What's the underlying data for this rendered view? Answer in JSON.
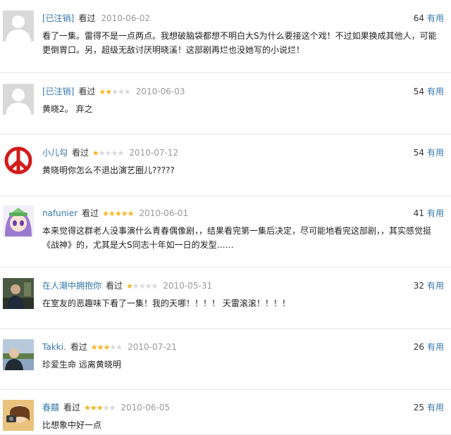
{
  "labels": {
    "watched": "看过",
    "useful": "有用"
  },
  "colors": {
    "link": "#3377aa",
    "star": "#f4b51e",
    "star_empty": "#d8d8d8",
    "date": "#999999"
  },
  "comments": [
    {
      "user": "[已注销]",
      "avatar": "default-avatar-icon",
      "rating": 0,
      "date": "2010-06-02",
      "votes": "64",
      "text": "看了一集。雷得不是一点两点。我想破脑袋都想不明白大S为什么要接这个戏！不过如果换成其他人，可能更倒胃口。另，超级无敌讨厌明晓溪！这部剧再烂也没她写的小说烂！"
    },
    {
      "user": "[已注销]",
      "avatar": "default-avatar-icon",
      "rating": 2,
      "date": "2010-06-03",
      "votes": "54",
      "text": "黄晓2。 弃之"
    },
    {
      "user": "小儿勾",
      "avatar": "peace-sign-icon",
      "rating": 1,
      "date": "2010-07-12",
      "votes": "54",
      "text": "黄晓明你怎么不退出演艺圈儿?????"
    },
    {
      "user": "nafunier",
      "avatar": "anime-girl-avatar-icon",
      "rating": 5,
      "date": "2010-06-01",
      "votes": "41",
      "text": "本来觉得这群老人没事演什么青春偶像剧，，结果看完第一集后决定，尽可能地看完这部剧，，其实感觉挺《战神》的，尤其是大S同志十年如一日的发型……"
    },
    {
      "user": "在人潮中拥抱你",
      "avatar": "person-photo-avatar-icon",
      "rating": 1,
      "date": "2010-05-31",
      "votes": "32",
      "text": "在室友的恶趣味下看了一集！我的天哪！！！！ 天雷滚滚！！！！"
    },
    {
      "user": "Takki.",
      "avatar": "lake-photo-avatar-icon",
      "rating": 3,
      "date": "2010-07-21",
      "votes": "26",
      "text": "珍爱生命 远离黄晓明"
    },
    {
      "user": "春囍",
      "avatar": "selfie-photo-avatar-icon",
      "rating": 3,
      "date": "2010-06-05",
      "votes": "25",
      "text": "比想象中好一点"
    }
  ]
}
